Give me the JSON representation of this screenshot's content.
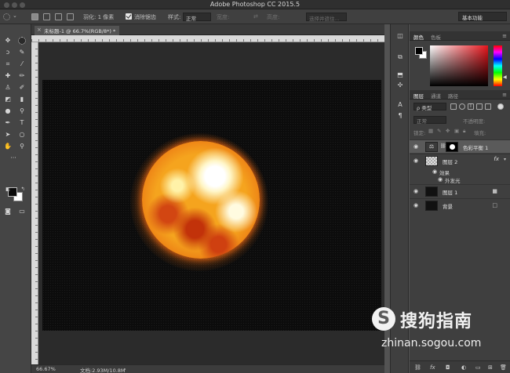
{
  "app": {
    "title": "Adobe Photoshop CC 2015.5"
  },
  "options_bar": {
    "feather_label": "羽化: 1 像素",
    "antialias_label": "消除锯齿",
    "style_label": "样式:",
    "style_value": "正常",
    "width_label": "宽度:",
    "height_label": "高度:",
    "select_mask_button": "选择并遮住...",
    "workspace": "基本功能"
  },
  "document": {
    "tab_label": "未标题-1 @ 66.7%(RGB/8*) *",
    "zoom": "66.67%",
    "doc_size": "文档:2.93M/10.8M"
  },
  "color_panel": {
    "tabs": [
      "颜色",
      "色板"
    ],
    "foreground": "#000000",
    "background": "#ffffff"
  },
  "layers_panel": {
    "tabs": [
      "图层",
      "通道",
      "路径"
    ],
    "filter_kind": "ρ 类型",
    "blend_mode": "正常",
    "opacity_label": "不透明度:",
    "lock_label": "锁定:",
    "fill_label": "填充:",
    "layers": [
      {
        "name": "色彩平衡 1",
        "type": "adjustment"
      },
      {
        "name": "图层 2",
        "type": "effect-layer",
        "fx": "fx",
        "effects_label": "效果",
        "effect": "外发光"
      },
      {
        "name": "图层 1",
        "type": "locked"
      },
      {
        "name": "背景",
        "type": "background"
      }
    ]
  },
  "watermark": {
    "name": "搜狗指南",
    "url": "zhinan.sogou.com"
  }
}
